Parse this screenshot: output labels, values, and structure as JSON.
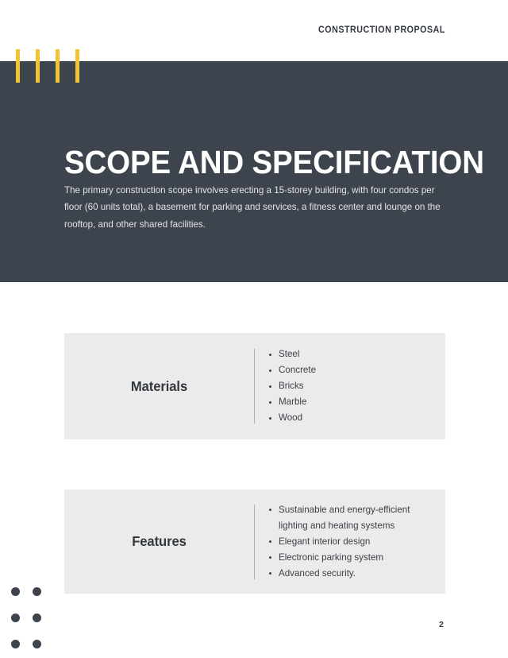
{
  "document": {
    "header_title": "CONSTRUCTION PROPOSAL",
    "page_number": "2"
  },
  "hero": {
    "title": "SCOPE AND SPECIFICATION",
    "paragraph": "The primary construction scope involves erecting a 15-storey building, with four condos per floor (60 units total), a basement for parking and services, a fitness center and lounge on the rooftop, and other shared facilities."
  },
  "decor": {
    "bars_count": 4,
    "bar_color": "#f2c335",
    "hero_color": "#3e444d",
    "card_color": "#ebebeb",
    "dot_color": "#3e444d",
    "dot_rows": 3,
    "dot_columns": 2
  },
  "cards": [
    {
      "label": "Materials",
      "items": [
        "Steel",
        "Concrete",
        "Bricks",
        "Marble",
        "Wood"
      ]
    },
    {
      "label": "Features",
      "items": [
        "Sustainable and energy-efficient lighting and heating systems",
        "Elegant interior design",
        "Electronic parking system",
        "Advanced security."
      ]
    }
  ]
}
